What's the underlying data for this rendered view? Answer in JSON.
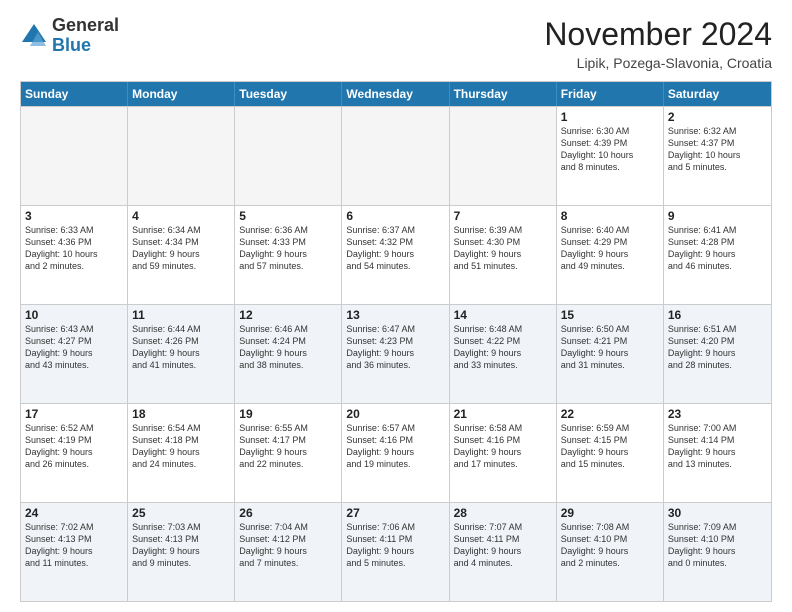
{
  "header": {
    "logo_general": "General",
    "logo_blue": "Blue",
    "month_title": "November 2024",
    "location": "Lipik, Pozega-Slavonia, Croatia"
  },
  "calendar": {
    "days_of_week": [
      "Sunday",
      "Monday",
      "Tuesday",
      "Wednesday",
      "Thursday",
      "Friday",
      "Saturday"
    ],
    "rows": [
      [
        {
          "day": "",
          "empty": true
        },
        {
          "day": "",
          "empty": true
        },
        {
          "day": "",
          "empty": true
        },
        {
          "day": "",
          "empty": true
        },
        {
          "day": "",
          "empty": true
        },
        {
          "day": "1",
          "info": "Sunrise: 6:30 AM\nSunset: 4:39 PM\nDaylight: 10 hours\nand 8 minutes."
        },
        {
          "day": "2",
          "info": "Sunrise: 6:32 AM\nSunset: 4:37 PM\nDaylight: 10 hours\nand 5 minutes."
        }
      ],
      [
        {
          "day": "3",
          "info": "Sunrise: 6:33 AM\nSunset: 4:36 PM\nDaylight: 10 hours\nand 2 minutes."
        },
        {
          "day": "4",
          "info": "Sunrise: 6:34 AM\nSunset: 4:34 PM\nDaylight: 9 hours\nand 59 minutes."
        },
        {
          "day": "5",
          "info": "Sunrise: 6:36 AM\nSunset: 4:33 PM\nDaylight: 9 hours\nand 57 minutes."
        },
        {
          "day": "6",
          "info": "Sunrise: 6:37 AM\nSunset: 4:32 PM\nDaylight: 9 hours\nand 54 minutes."
        },
        {
          "day": "7",
          "info": "Sunrise: 6:39 AM\nSunset: 4:30 PM\nDaylight: 9 hours\nand 51 minutes."
        },
        {
          "day": "8",
          "info": "Sunrise: 6:40 AM\nSunset: 4:29 PM\nDaylight: 9 hours\nand 49 minutes."
        },
        {
          "day": "9",
          "info": "Sunrise: 6:41 AM\nSunset: 4:28 PM\nDaylight: 9 hours\nand 46 minutes."
        }
      ],
      [
        {
          "day": "10",
          "info": "Sunrise: 6:43 AM\nSunset: 4:27 PM\nDaylight: 9 hours\nand 43 minutes."
        },
        {
          "day": "11",
          "info": "Sunrise: 6:44 AM\nSunset: 4:26 PM\nDaylight: 9 hours\nand 41 minutes."
        },
        {
          "day": "12",
          "info": "Sunrise: 6:46 AM\nSunset: 4:24 PM\nDaylight: 9 hours\nand 38 minutes."
        },
        {
          "day": "13",
          "info": "Sunrise: 6:47 AM\nSunset: 4:23 PM\nDaylight: 9 hours\nand 36 minutes."
        },
        {
          "day": "14",
          "info": "Sunrise: 6:48 AM\nSunset: 4:22 PM\nDaylight: 9 hours\nand 33 minutes."
        },
        {
          "day": "15",
          "info": "Sunrise: 6:50 AM\nSunset: 4:21 PM\nDaylight: 9 hours\nand 31 minutes."
        },
        {
          "day": "16",
          "info": "Sunrise: 6:51 AM\nSunset: 4:20 PM\nDaylight: 9 hours\nand 28 minutes."
        }
      ],
      [
        {
          "day": "17",
          "info": "Sunrise: 6:52 AM\nSunset: 4:19 PM\nDaylight: 9 hours\nand 26 minutes."
        },
        {
          "day": "18",
          "info": "Sunrise: 6:54 AM\nSunset: 4:18 PM\nDaylight: 9 hours\nand 24 minutes."
        },
        {
          "day": "19",
          "info": "Sunrise: 6:55 AM\nSunset: 4:17 PM\nDaylight: 9 hours\nand 22 minutes."
        },
        {
          "day": "20",
          "info": "Sunrise: 6:57 AM\nSunset: 4:16 PM\nDaylight: 9 hours\nand 19 minutes."
        },
        {
          "day": "21",
          "info": "Sunrise: 6:58 AM\nSunset: 4:16 PM\nDaylight: 9 hours\nand 17 minutes."
        },
        {
          "day": "22",
          "info": "Sunrise: 6:59 AM\nSunset: 4:15 PM\nDaylight: 9 hours\nand 15 minutes."
        },
        {
          "day": "23",
          "info": "Sunrise: 7:00 AM\nSunset: 4:14 PM\nDaylight: 9 hours\nand 13 minutes."
        }
      ],
      [
        {
          "day": "24",
          "info": "Sunrise: 7:02 AM\nSunset: 4:13 PM\nDaylight: 9 hours\nand 11 minutes."
        },
        {
          "day": "25",
          "info": "Sunrise: 7:03 AM\nSunset: 4:13 PM\nDaylight: 9 hours\nand 9 minutes."
        },
        {
          "day": "26",
          "info": "Sunrise: 7:04 AM\nSunset: 4:12 PM\nDaylight: 9 hours\nand 7 minutes."
        },
        {
          "day": "27",
          "info": "Sunrise: 7:06 AM\nSunset: 4:11 PM\nDaylight: 9 hours\nand 5 minutes."
        },
        {
          "day": "28",
          "info": "Sunrise: 7:07 AM\nSunset: 4:11 PM\nDaylight: 9 hours\nand 4 minutes."
        },
        {
          "day": "29",
          "info": "Sunrise: 7:08 AM\nSunset: 4:10 PM\nDaylight: 9 hours\nand 2 minutes."
        },
        {
          "day": "30",
          "info": "Sunrise: 7:09 AM\nSunset: 4:10 PM\nDaylight: 9 hours\nand 0 minutes."
        }
      ]
    ]
  }
}
